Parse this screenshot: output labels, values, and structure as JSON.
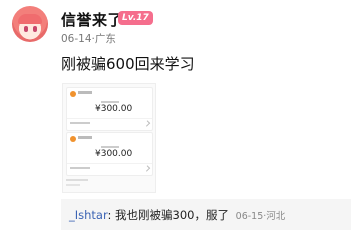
{
  "post": {
    "author": {
      "name": "信誉来了",
      "level_badge": "Lv.17",
      "date": "06-14",
      "location": "广东"
    },
    "text": "刚被骗600回来学习",
    "image": {
      "payments": [
        {
          "amount": "¥300.00"
        },
        {
          "amount": "¥300.00"
        }
      ]
    }
  },
  "reply": {
    "user": "_Ishtar",
    "separator": ": ",
    "text": "我也刚被骗300，服了",
    "date": "06-15",
    "location": "河北"
  },
  "colors": {
    "level_badge": "#f56e8d",
    "reply_user": "#3c64b4",
    "reply_background": "#f5f5f5"
  }
}
